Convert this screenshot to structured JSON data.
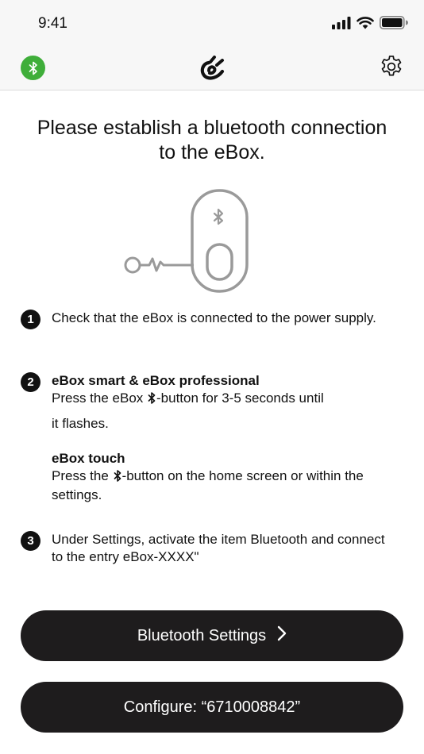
{
  "status_bar": {
    "time": "9:41",
    "icons": [
      "signal-icon",
      "wifi-icon",
      "battery-icon"
    ]
  },
  "nav": {
    "left_icon": "bluetooth-connected-icon",
    "logo_icon": "brand-logo-icon",
    "right_icon": "gear-icon"
  },
  "main": {
    "title": "Please establish a bluetooth connection to the eBox.",
    "steps": [
      {
        "number": "1",
        "text": "Check that the eBox is connected to the power supply."
      },
      {
        "number": "2",
        "heading_a": "eBox smart & eBox professional",
        "text_a_before": "Press the eBox",
        "text_a_after": "-button for 3-5 seconds until",
        "text_a_line2": "it flashes.",
        "heading_b": "eBox touch",
        "text_b_before": "Press the",
        "text_b_after": "-button on the home screen or within the settings."
      },
      {
        "number": "3",
        "text": "Under Settings, activate the item Bluetooth and connect to the entry eBox-XXXX\""
      }
    ]
  },
  "buttons": {
    "bluetooth_settings": "Bluetooth Settings",
    "configure": "Configure: “6710008842”"
  },
  "colors": {
    "accent_green": "#3fae3a",
    "button_bg": "#1e1c1d",
    "header_bg": "#f7f7f7",
    "illustration_gray": "#9a9a9a"
  }
}
